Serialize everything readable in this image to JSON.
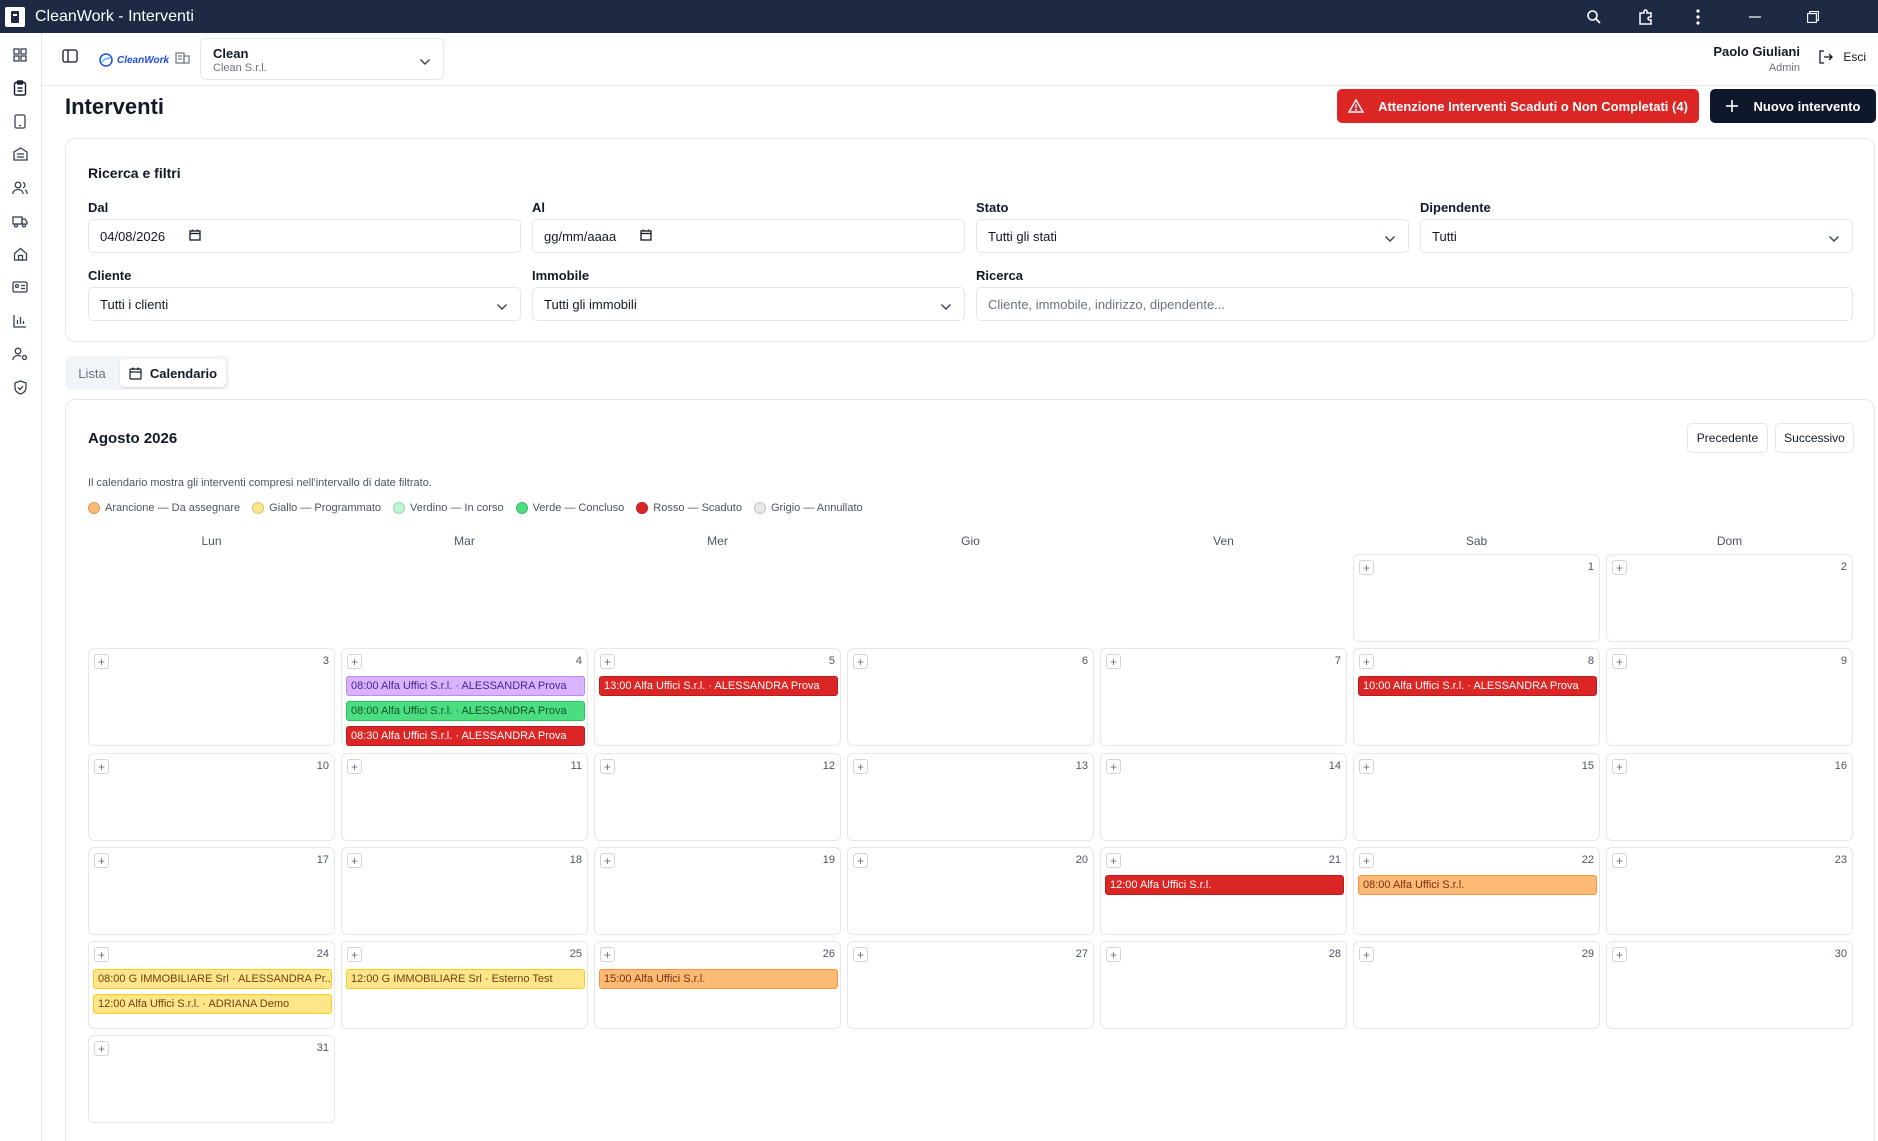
{
  "window": {
    "title": "CleanWork - Interventi"
  },
  "topbar": {
    "logo_text": "CleanWork",
    "company_name": "Clean",
    "company_sub": "Clean S.r.l.",
    "user_name": "Paolo Giuliani",
    "user_role": "Admin",
    "logout_label": "Esci"
  },
  "header": {
    "title": "Interventi",
    "alert_label": "Attenzione Interventi Scaduti o Non Completati (4)",
    "new_label": "Nuovo intervento"
  },
  "filters": {
    "title": "Ricerca e filtri",
    "dal_label": "Dal",
    "dal_value": "04/08/2026",
    "al_label": "Al",
    "al_value": "gg/mm/aaaa",
    "stato_label": "Stato",
    "stato_value": "Tutti gli stati",
    "dipendente_label": "Dipendente",
    "dipendente_value": "Tutti",
    "cliente_label": "Cliente",
    "cliente_value": "Tutti i clienti",
    "immobile_label": "Immobile",
    "immobile_value": "Tutti gli immobili",
    "ricerca_label": "Ricerca",
    "ricerca_placeholder": "Cliente, immobile, indirizzo, dipendente..."
  },
  "tabs": {
    "lista": "Lista",
    "calendario": "Calendario"
  },
  "calendar": {
    "title": "Agosto 2026",
    "prev_label": "Precedente",
    "next_label": "Successivo",
    "note": "Il calendario mostra gli interventi compresi nell'intervallo di date filtrato.",
    "legend": [
      {
        "label": "Arancione — Da assegnare",
        "color": "#fdba74"
      },
      {
        "label": "Giallo — Programmato",
        "color": "#fde68a"
      },
      {
        "label": "Verdino — In corso",
        "color": "#bbf7d0"
      },
      {
        "label": "Verde — Concluso",
        "color": "#4ade80"
      },
      {
        "label": "Rosso — Scaduto",
        "color": "#dc2626"
      },
      {
        "label": "Grigio — Annullato",
        "color": "#e5e7eb"
      }
    ],
    "weekdays": [
      "Lun",
      "Mar",
      "Mer",
      "Gio",
      "Ven",
      "Sab",
      "Dom"
    ],
    "first_weekday_index": 5,
    "days_in_month": 31,
    "events": {
      "4": [
        {
          "text": "08:00 Alfa Uffici S.r.l. · ALESSANDRA Prova",
          "color": "lilac"
        },
        {
          "text": "08:00 Alfa Uffici S.r.l. · ALESSANDRA Prova",
          "color": "green"
        },
        {
          "text": "08:30 Alfa Uffici S.r.l. · ALESSANDRA Prova",
          "color": "red"
        }
      ],
      "5": [
        {
          "text": "13:00 Alfa Uffici S.r.l. · ALESSANDRA Prova",
          "color": "red"
        }
      ],
      "8": [
        {
          "text": "10:00 Alfa Uffici S.r.l. · ALESSANDRA Prova",
          "color": "red"
        }
      ],
      "21": [
        {
          "text": "12:00 Alfa Uffici S.r.l.",
          "color": "red"
        }
      ],
      "22": [
        {
          "text": "08:00 Alfa Uffici S.r.l.",
          "color": "orange"
        }
      ],
      "24": [
        {
          "text": "08:00 G IMMOBILIARE Srl · ALESSANDRA Pr...",
          "color": "yellow"
        },
        {
          "text": "12:00 Alfa Uffici S.r.l. · ADRIANA Demo",
          "color": "yellow"
        }
      ],
      "25": [
        {
          "text": "12:00 G IMMOBILIARE Srl · Esterno Test",
          "color": "yellow"
        }
      ],
      "26": [
        {
          "text": "15:00 Alfa Uffici S.r.l.",
          "color": "orange"
        }
      ]
    }
  }
}
